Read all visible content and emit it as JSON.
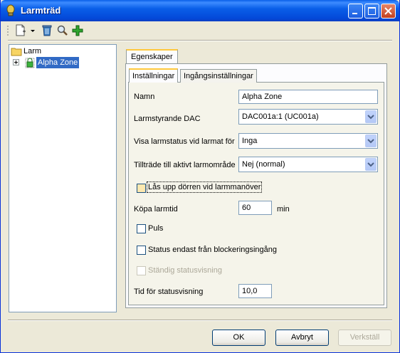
{
  "window": {
    "title": "Larmträd"
  },
  "toolbar": {
    "new_icon": "new-document-icon",
    "dropdown_icon": "chevron-down-icon",
    "delete_icon": "trash-icon",
    "find_icon": "magnifier-icon",
    "add_icon": "plus-icon"
  },
  "tree": {
    "root_label": "Larm",
    "child_label": "Alpha Zone"
  },
  "tabs": {
    "outer": "Egenskaper",
    "inner_active": "Inställningar",
    "inner_other": "Ingångsinställningar"
  },
  "form": {
    "name_label": "Namn",
    "name_value": "Alpha Zone",
    "dac_label": "Larmstyrande DAC",
    "dac_value": "DAC001a:1 (UC001a)",
    "status_label": "Visa larmstatus vid larmat för",
    "status_value": "Inga",
    "access_label": "Tillträde till aktivt larmområde",
    "access_value": "Nej (normal)",
    "unlock_label": "Lås upp dörren vid larmmanöver",
    "buy_time_label": "Köpa larmtid",
    "buy_time_value": "60",
    "buy_time_unit": "min",
    "pulse_label": "Puls",
    "status_block_label": "Status endast från blockeringsingång",
    "permanent_label": "Ständig statusvisning",
    "status_time_label": "Tid för statusvisning",
    "status_time_value": "10,0"
  },
  "buttons": {
    "ok": "OK",
    "cancel": "Avbryt",
    "apply": "Verkställ"
  }
}
